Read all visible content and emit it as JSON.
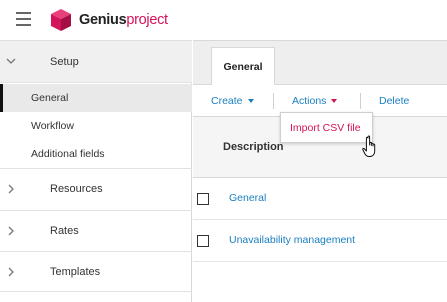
{
  "app": {
    "logo_text_bold": "Genius",
    "logo_text_light": "project",
    "brand_color": "#d4145a",
    "link_color": "#1a7fc0"
  },
  "topbar": {
    "menu_icon": "hamburger-menu-icon"
  },
  "sidebar": {
    "setup": {
      "label": "Setup",
      "expanded": true
    },
    "setup_items": [
      {
        "label": "General",
        "active": true
      },
      {
        "label": "Workflow",
        "active": false
      },
      {
        "label": "Additional fields",
        "active": false
      }
    ],
    "sections": [
      {
        "label": "Resources",
        "expanded": false
      },
      {
        "label": "Rates",
        "expanded": false
      },
      {
        "label": "Templates",
        "expanded": false
      }
    ]
  },
  "main": {
    "tabs": [
      {
        "label": "General",
        "active": true
      }
    ],
    "toolbar": {
      "create_label": "Create",
      "actions_label": "Actions",
      "delete_label": "Delete"
    },
    "actions_menu": {
      "open": true,
      "items": [
        {
          "label": "Import CSV file"
        }
      ]
    },
    "table": {
      "header_description": "Description",
      "rows": [
        {
          "description": "General"
        },
        {
          "description": "Unavailability management"
        }
      ]
    }
  }
}
